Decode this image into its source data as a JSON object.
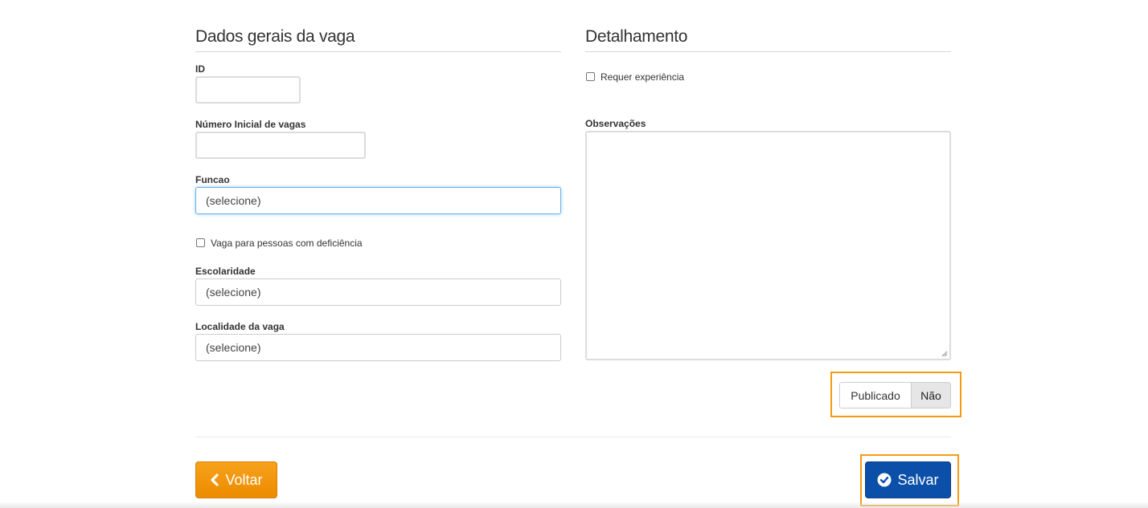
{
  "left_section": {
    "title": "Dados gerais da vaga",
    "id_label": "ID",
    "id_value": "",
    "numero_label": "Número Inicial de vagas",
    "numero_value": "",
    "funcao_label": "Funcao",
    "funcao_value": "(selecione)",
    "pcd_label": "Vaga para pessoas com deficiência",
    "escolaridade_label": "Escolaridade",
    "escolaridade_value": "(selecione)",
    "localidade_label": "Localidade da vaga",
    "localidade_value": "(selecione)"
  },
  "right_section": {
    "title": "Detalhamento",
    "requer_label": "Requer experiência",
    "observacoes_label": "Observações",
    "observacoes_value": ""
  },
  "publish_toggle": {
    "label": "Publicado",
    "value": "Não"
  },
  "actions": {
    "back_label": "Voltar",
    "save_label": "Salvar"
  },
  "colors": {
    "highlight": "#f39c12",
    "back_button": "#f39c12",
    "save_button": "#0b4fa8",
    "focus_border": "#66afe9"
  },
  "icons": {
    "back": "chevron-left-icon",
    "save": "check-circle-icon"
  }
}
